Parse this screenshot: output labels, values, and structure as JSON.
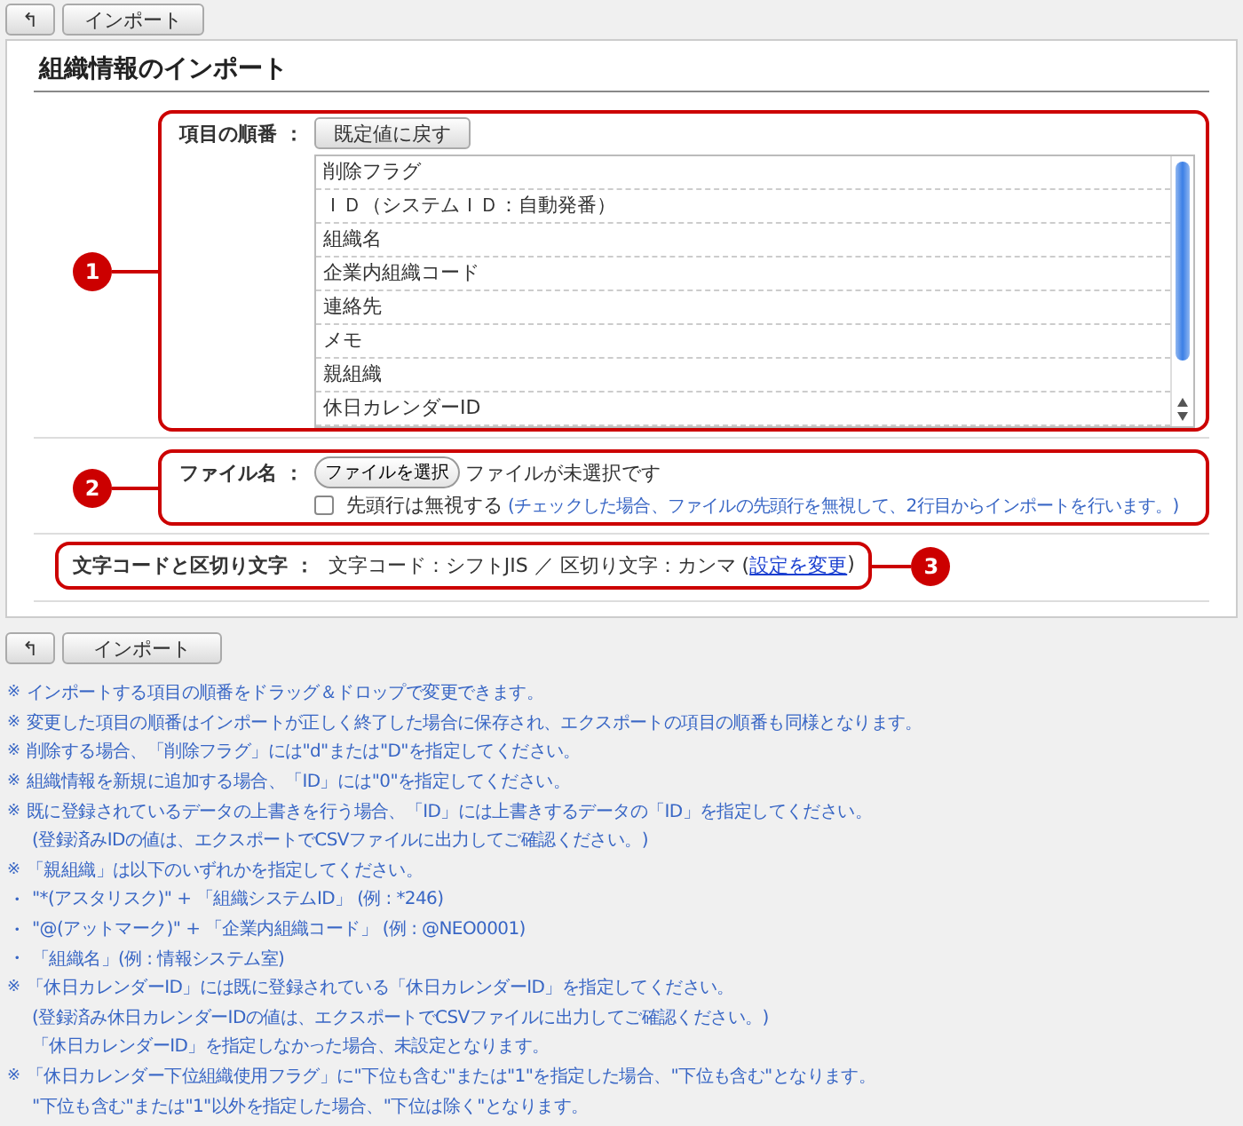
{
  "toolbar_top": {
    "back": "↰",
    "import": "インポート"
  },
  "title": "組織情報のインポート",
  "order": {
    "badge": "1",
    "label": "項目の順番 ：",
    "reset": "既定値に戻す",
    "items": [
      "削除フラグ",
      "ＩＤ（システムＩＤ：自動発番）",
      "組織名",
      "企業内組織コード",
      "連絡先",
      "メモ",
      "親組織",
      "休日カレンダーID"
    ]
  },
  "file": {
    "badge": "2",
    "label": "ファイル名 ：",
    "choose": "ファイルを選択",
    "status": "ファイルが未選択です",
    "skip_header": {
      "label": "先頭行は無視する",
      "checked": false,
      "hint": "(チェックした場合、ファイルの先頭行を無視して、2行目からインポートを行います。)"
    }
  },
  "encoding": {
    "badge": "3",
    "label": "文字コードと区切り文字 ：",
    "value": "文字コード：シフトJIS ／ 区切り文字：カンマ (",
    "link": "設定を変更",
    "after": ")"
  },
  "toolbar_bottom": {
    "back": "↰",
    "import": "インポート"
  },
  "notes": [
    {
      "kind": "note",
      "mark": "※",
      "text": "インポートする項目の順番をドラッグ＆ドロップで変更できます。"
    },
    {
      "kind": "note",
      "mark": "※",
      "text": "変更した項目の順番はインポートが正しく終了した場合に保存され、エクスポートの項目の順番も同様となります。"
    },
    {
      "kind": "note",
      "mark": "※",
      "text": "削除する場合、「削除フラグ」には\"d\"または\"D\"を指定してください。"
    },
    {
      "kind": "note",
      "mark": "※",
      "text": "組織情報を新規に追加する場合、「ID」には\"0\"を指定してください。"
    },
    {
      "kind": "note",
      "mark": "※",
      "text": "既に登録されているデータの上書きを行う場合、「ID」には上書きするデータの「ID」を指定してください。"
    },
    {
      "kind": "cont",
      "text": "(登録済みIDの値は、エクスポートでCSVファイルに出力してご確認ください。)"
    },
    {
      "kind": "note",
      "mark": "※",
      "text": "「親組織」は以下のいずれかを指定してください。"
    },
    {
      "kind": "sub",
      "mark": "・",
      "text": "\"*(アスタリスク)\" + 「組織システムID」 (例 : *246)"
    },
    {
      "kind": "sub",
      "mark": "・",
      "text": "\"@(アットマーク)\" + 「企業内組織コード」 (例 : @NEO0001)"
    },
    {
      "kind": "sub",
      "mark": "・",
      "text": "「組織名」(例 : 情報システム室)"
    },
    {
      "kind": "note",
      "mark": "※",
      "text": "「休日カレンダーID」には既に登録されている「休日カレンダーID」を指定してください。"
    },
    {
      "kind": "cont",
      "text": "(登録済み休日カレンダーIDの値は、エクスポートでCSVファイルに出力してご確認ください。)"
    },
    {
      "kind": "cont",
      "text": "「休日カレンダーID」を指定しなかった場合、未設定となります。"
    },
    {
      "kind": "note",
      "mark": "※",
      "text": "「休日カレンダー下位組織使用フラグ」に\"下位も含む\"または\"1\"を指定した場合、\"下位も含む\"となります。"
    },
    {
      "kind": "cont",
      "text": "\"下位も含む\"または\"1\"以外を指定した場合、\"下位は除く\"となります。"
    }
  ]
}
